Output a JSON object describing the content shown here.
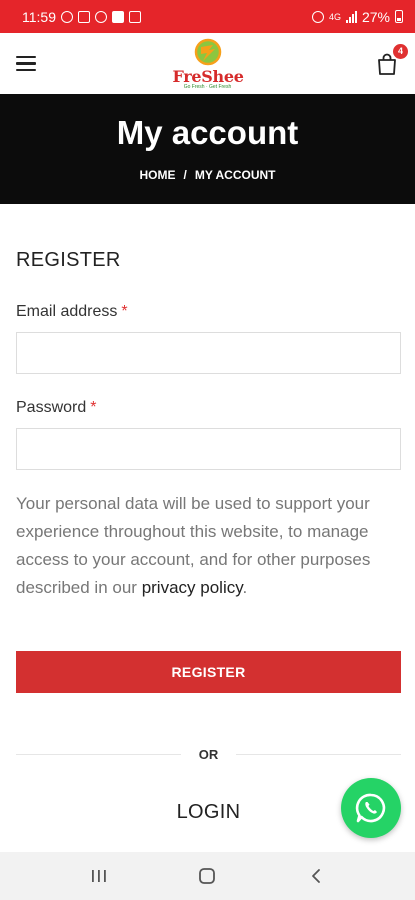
{
  "status_bar": {
    "time": "11:59",
    "battery": "27%"
  },
  "header": {
    "logo_text": "FreShee",
    "logo_tagline": "Go Fresh · Get Fresh",
    "cart_count": "4"
  },
  "banner": {
    "title": "My account",
    "breadcrumb": {
      "home": "HOME",
      "separator": "/",
      "current": "MY ACCOUNT"
    }
  },
  "register": {
    "section_title": "REGISTER",
    "email_label": "Email address",
    "email_value": "",
    "password_label": "Password",
    "password_value": "",
    "required_mark": "*",
    "privacy_text": "Your personal data will be used to support your experience throughout this website, to manage access to your account, and for other purposes described in our ",
    "privacy_link": "privacy policy",
    "privacy_end": ".",
    "button_label": "REGISTER"
  },
  "divider_label": "OR",
  "login": {
    "section_title": "LOGIN"
  },
  "colors": {
    "brand_red": "#e5252a",
    "button_red": "#d33030",
    "banner_black": "#0c0c0c",
    "whatsapp_green": "#25d366"
  },
  "icons": {
    "menu": "hamburger-icon",
    "cart": "shopping-bag-icon",
    "whatsapp": "whatsapp-icon",
    "nav_recent": "recent-apps-icon",
    "nav_home": "home-icon",
    "nav_back": "back-icon"
  }
}
